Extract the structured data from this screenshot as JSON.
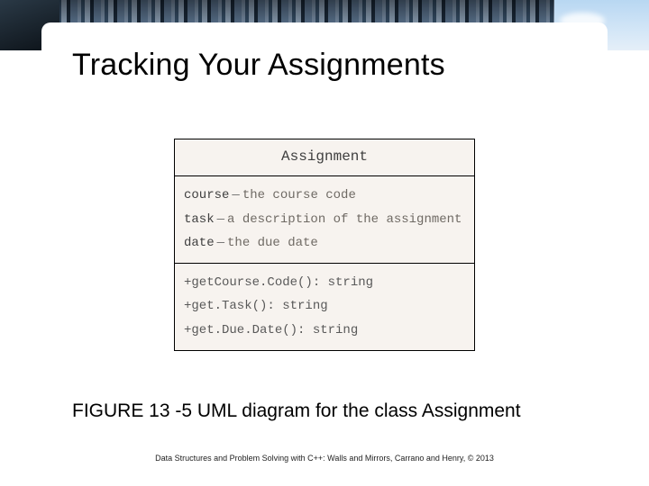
{
  "title": "Tracking Your Assignments",
  "uml": {
    "class_name": "Assignment",
    "attributes": [
      {
        "name": "course",
        "desc": "the course code"
      },
      {
        "name": "task",
        "desc": "a description of the assignment"
      },
      {
        "name": "date",
        "desc": "the due date"
      }
    ],
    "operations": [
      "+getCourse.Code(): string",
      "+get.Task(): string",
      "+get.Due.Date(): string"
    ]
  },
  "caption": "FIGURE 13 -5 UML diagram for the class Assignment",
  "footer": "Data Structures and Problem Solving with C++: Walls and Mirrors, Carrano and Henry, © 2013",
  "sep": "—"
}
